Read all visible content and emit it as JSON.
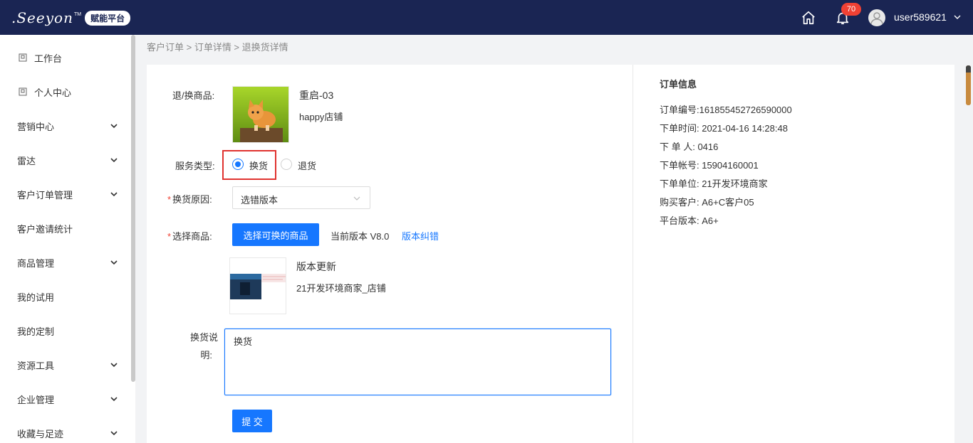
{
  "header": {
    "logo_text": ".Seeyon",
    "logo_tm": "TM",
    "platform_badge": "赋能平台",
    "notification_count": "70",
    "username": "user589621"
  },
  "sidebar": {
    "items": [
      {
        "label": "工作台",
        "icon": "square-icon",
        "expandable": false
      },
      {
        "label": "个人中心",
        "icon": "square-icon",
        "expandable": false
      },
      {
        "label": "营销中心",
        "expandable": true
      },
      {
        "label": "雷达",
        "expandable": true
      },
      {
        "label": "客户订单管理",
        "expandable": true
      },
      {
        "label": "客户邀请统计",
        "expandable": false
      },
      {
        "label": "商品管理",
        "expandable": true
      },
      {
        "label": "我的试用",
        "expandable": false
      },
      {
        "label": "我的定制",
        "expandable": false
      },
      {
        "label": "资源工具",
        "expandable": true
      },
      {
        "label": "企业管理",
        "expandable": true
      },
      {
        "label": "收藏与足迹",
        "expandable": true
      }
    ]
  },
  "breadcrumb": {
    "text": "客户订单 > 订单详情 > 退换货详情"
  },
  "form": {
    "return_product_label": "退/换商品:",
    "product1": {
      "name": "重启-03",
      "shop": "happy店铺"
    },
    "service_type_label": "服务类型:",
    "service_options": [
      {
        "label": "换货",
        "checked": true
      },
      {
        "label": "退货",
        "checked": false
      }
    ],
    "reason_label": "换货原因:",
    "reason_value": "选错版本",
    "select_product_label": "选择商品:",
    "select_button": "选择可换的商品",
    "current_version": "当前版本 V8.0",
    "version_link": "版本纠错",
    "product2": {
      "name": "版本更新",
      "shop": "21开发环境商家_店铺"
    },
    "desc_label_line1": "换货说",
    "desc_label_line2": "明:",
    "desc_value": "换货",
    "submit_button": "提 交"
  },
  "order_info": {
    "title": "订单信息",
    "rows": [
      "订单编号:161855452726590000",
      "下单时间:  2021-04-16 14:28:48",
      "下 单 人:  0416",
      "下单帐号:  15904160001",
      "下单单位:  21开发环境商家",
      "购买客户:  A6+C客户05",
      "平台版本:  A6+"
    ]
  },
  "colors": {
    "header_bg": "#1a2553",
    "primary": "#1677ff",
    "highlight_border": "#e0332f",
    "badge_red": "#f04134"
  }
}
